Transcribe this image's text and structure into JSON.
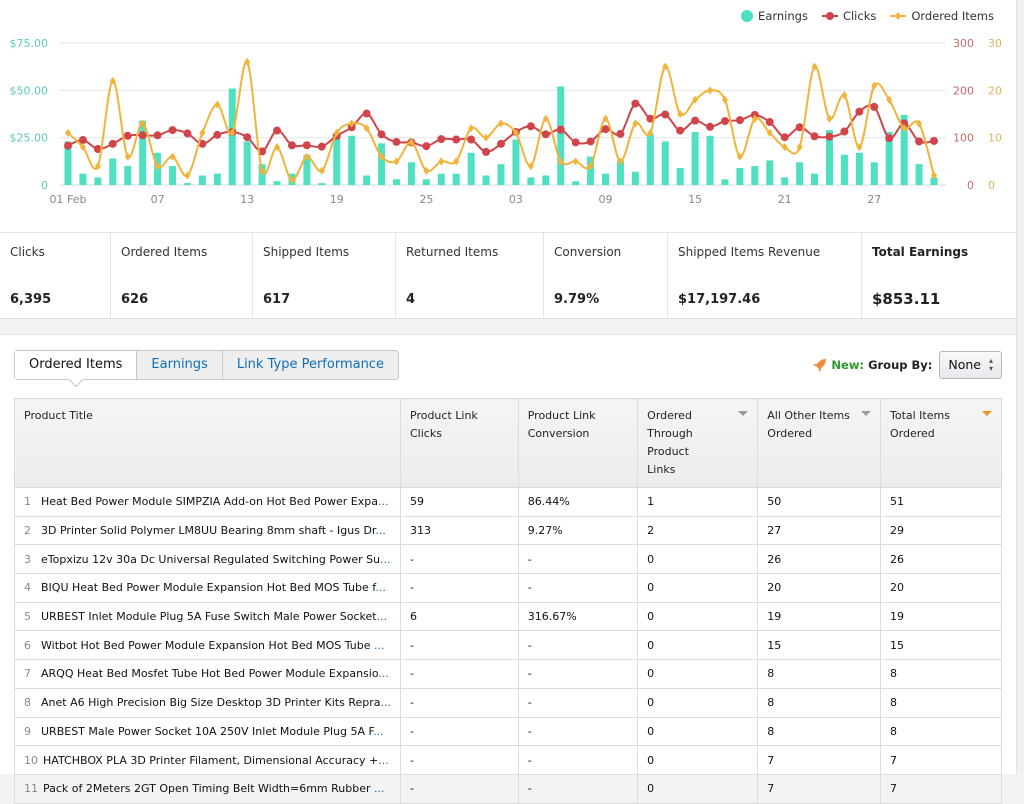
{
  "legend": {
    "earnings": "Earnings",
    "clicks": "Clicks",
    "ordered": "Ordered Items"
  },
  "colors": {
    "earnings": "#4fe0c2",
    "clicks": "#d0454c",
    "ordered": "#f0b43a",
    "earnings_axis": "#5ec9b4",
    "clicks_axis": "#c96a6a",
    "ordered_axis": "#e3b05a",
    "link": "#0f6fb8",
    "new": "#2b9a2b"
  },
  "chart_data": {
    "type": "bar",
    "title": "",
    "xlabel": "",
    "ylabel": "Earnings",
    "grid": true,
    "legend_position": "top-right",
    "x_tick_labels": [
      "01 Feb",
      "07",
      "13",
      "19",
      "25",
      "03",
      "09",
      "15",
      "21",
      "27"
    ],
    "x_tick_indices": [
      0,
      6,
      12,
      18,
      24,
      30,
      36,
      42,
      48,
      54
    ],
    "y_left": {
      "label": "Earnings",
      "ticks": [
        "0",
        "$25.00",
        "$50.00",
        "$75.00"
      ],
      "range": [
        0,
        75
      ]
    },
    "y_right_clicks": {
      "ticks": [
        "0",
        "100",
        "200",
        "300"
      ],
      "range": [
        0,
        300
      ]
    },
    "y_right_ordered": {
      "ticks": [
        "0",
        "10",
        "20",
        "30"
      ],
      "range": [
        0,
        30
      ]
    },
    "series": [
      {
        "name": "Earnings",
        "type": "bar",
        "values": [
          23,
          6,
          4,
          14,
          10,
          34,
          17,
          10,
          1,
          5,
          6,
          51,
          23,
          11,
          2,
          6,
          16,
          1,
          25,
          26,
          5,
          22,
          3,
          12,
          3,
          6,
          6,
          17,
          5,
          11,
          24,
          4,
          5,
          52,
          2,
          15,
          6,
          13,
          7,
          27,
          23,
          9,
          28,
          26,
          3,
          9,
          10,
          13,
          4,
          12,
          6,
          29,
          16,
          17,
          12,
          28,
          37,
          11,
          4
        ]
      },
      {
        "name": "Clicks",
        "type": "line",
        "values": [
          83,
          95,
          76,
          87,
          104,
          105,
          105,
          116,
          109,
          87,
          106,
          112,
          101,
          71,
          115,
          84,
          84,
          81,
          104,
          122,
          151,
          107,
          91,
          90,
          82,
          97,
          96,
          96,
          70,
          87,
          112,
          124,
          107,
          117,
          90,
          92,
          118,
          108,
          172,
          140,
          149,
          115,
          136,
          123,
          135,
          137,
          148,
          133,
          101,
          122,
          103,
          102,
          113,
          155,
          165,
          99,
          130,
          92,
          93
        ]
      },
      {
        "name": "Ordered Items",
        "type": "line",
        "values": [
          11,
          8,
          4,
          22,
          6,
          13,
          4,
          6,
          2,
          11,
          17,
          11,
          26,
          3,
          8,
          1,
          6,
          3,
          11,
          13,
          12,
          6,
          5,
          9,
          3,
          5,
          5,
          12,
          10,
          13,
          11,
          4,
          14,
          5,
          5,
          4,
          14,
          5,
          13,
          11,
          25,
          15,
          18,
          20,
          18,
          6,
          14,
          11,
          8,
          8,
          25,
          14,
          19,
          8,
          21,
          18,
          12,
          13,
          2
        ]
      }
    ]
  },
  "stats": [
    {
      "label": "Clicks",
      "value": "6,395"
    },
    {
      "label": "Ordered Items",
      "value": "626"
    },
    {
      "label": "Shipped Items",
      "value": "617"
    },
    {
      "label": "Returned Items",
      "value": "4"
    },
    {
      "label": "Conversion",
      "value": "9.79%"
    },
    {
      "label": "Shipped Items Revenue",
      "value": "$17,197.46"
    },
    {
      "label": "Total Earnings",
      "value": "$853.11"
    }
  ],
  "tabs": [
    {
      "label": "Ordered Items",
      "active": true
    },
    {
      "label": "Earnings",
      "active": false
    },
    {
      "label": "Link Type Performance",
      "active": false
    }
  ],
  "group_by": {
    "new_label": "New:",
    "label": "Group By:",
    "value": "None"
  },
  "table": {
    "headers": [
      "Product Title",
      "Product Link Clicks",
      "Product Link Conversion",
      "Ordered Through Product Links",
      "All Other Items Ordered",
      "Total Items Ordered"
    ],
    "rows": [
      {
        "num": "1",
        "title": "Heat Bed Power Module SIMPZIA Add-on Hot Bed Power Expa",
        "clicks": "59",
        "conversion": "86.44%",
        "through": "1",
        "other": "50",
        "total": "51"
      },
      {
        "num": "2",
        "title": "3D Printer Solid Polymer LM8UU Bearing 8mm shaft - Igus Dr",
        "clicks": "313",
        "conversion": "9.27%",
        "through": "2",
        "other": "27",
        "total": "29"
      },
      {
        "num": "3",
        "title": "eTopxizu 12v 30a Dc Universal Regulated Switching Power Su",
        "clicks": "-",
        "conversion": "-",
        "through": "0",
        "other": "26",
        "total": "26"
      },
      {
        "num": "4",
        "title": "BIQU Heat Bed Power Module Expansion Hot Bed MOS Tube f",
        "clicks": "-",
        "conversion": "-",
        "through": "0",
        "other": "20",
        "total": "20"
      },
      {
        "num": "5",
        "title": "URBEST Inlet Module Plug 5A Fuse Switch Male Power Socket",
        "clicks": "6",
        "conversion": "316.67%",
        "through": "0",
        "other": "19",
        "total": "19"
      },
      {
        "num": "6",
        "title": "Witbot Hot Bed Power Module Expansion Hot Bed MOS Tube ",
        "clicks": "-",
        "conversion": "-",
        "through": "0",
        "other": "15",
        "total": "15"
      },
      {
        "num": "7",
        "title": "ARQQ Heat Bed Mosfet Tube Hot Bed Power Module Expansio",
        "clicks": "-",
        "conversion": "-",
        "through": "0",
        "other": "8",
        "total": "8"
      },
      {
        "num": "8",
        "title": "Anet A6 High Precision Big Size Desktop 3D Printer Kits Repra",
        "clicks": "-",
        "conversion": "-",
        "through": "0",
        "other": "8",
        "total": "8"
      },
      {
        "num": "9",
        "title": "URBEST Male Power Socket 10A 250V Inlet Module Plug 5A F",
        "clicks": "-",
        "conversion": "-",
        "through": "0",
        "other": "8",
        "total": "8"
      },
      {
        "num": "10",
        "title": "HATCHBOX PLA 3D Printer Filament, Dimensional Accuracy +",
        "clicks": "-",
        "conversion": "-",
        "through": "0",
        "other": "7",
        "total": "7"
      },
      {
        "num": "11",
        "title": "Pack of 2Meters 2GT Open Timing Belt Width=6mm Rubber ",
        "clicks": "-",
        "conversion": "-",
        "through": "0",
        "other": "7",
        "total": "7"
      }
    ],
    "ellipsis": "..."
  }
}
